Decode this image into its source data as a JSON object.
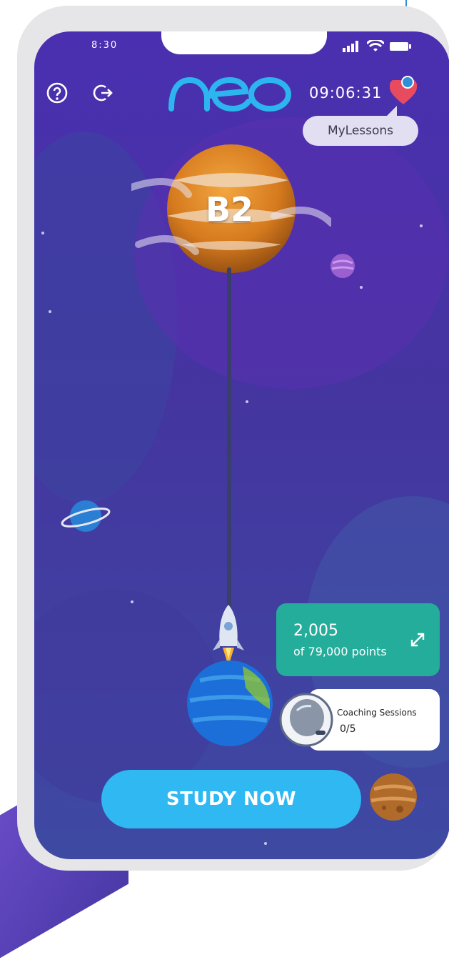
{
  "status_bar": {
    "time": "8:30"
  },
  "header": {
    "help_icon": "help-circle-icon",
    "logout_icon": "logout-icon",
    "logo": "neo",
    "timer": "09:06:31",
    "heart_icon": "heart-icon",
    "my_lessons_label": "MyLessons"
  },
  "map": {
    "level_label": "B2"
  },
  "points": {
    "value": "2,005",
    "total_label": "of 79,000 points"
  },
  "coaching": {
    "label": "Coaching Sessions",
    "value": "0/5"
  },
  "cta": {
    "label": "STUDY NOW"
  },
  "colors": {
    "bg_top": "#4a2fb0",
    "bg_bottom": "#3e4aa2",
    "accent_blue": "#2fb8f2",
    "points_teal": "#24ad9b",
    "heart_red": "#e84a5f",
    "logo_blue": "#2db5f0"
  }
}
